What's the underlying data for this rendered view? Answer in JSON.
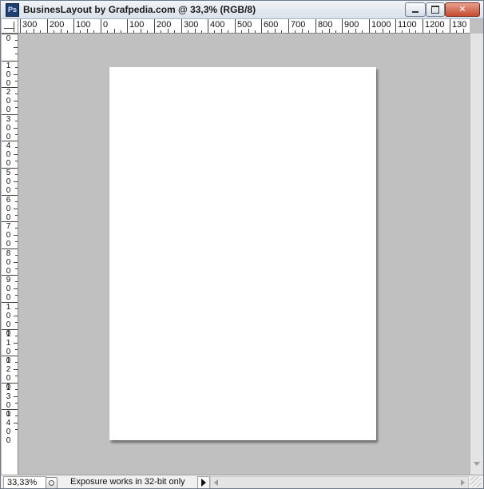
{
  "window": {
    "title": "BusinesLayout by Grafpedia.com @ 33,3% (RGB/8)",
    "app_icon": "Ps",
    "controls": [
      "minimize-icon",
      "maximize-icon",
      "close-icon"
    ]
  },
  "rulers": {
    "horizontal_labels": [
      "300",
      "200",
      "100",
      "0",
      "100",
      "200",
      "300",
      "400",
      "500",
      "600",
      "700",
      "800",
      "900",
      "1000",
      "1100",
      "1200",
      "130"
    ],
    "vertical_labels": [
      "0",
      "100",
      "200",
      "300",
      "400",
      "500",
      "600",
      "700",
      "800",
      "900",
      "1000",
      "1100",
      "1200",
      "1300",
      "1400"
    ],
    "unit": "px"
  },
  "document": {
    "background_color": "#ffffff",
    "canvas_color": "#c0c0c0"
  },
  "statusbar": {
    "zoom": "33,33%",
    "info": "Exposure works in 32-bit only"
  }
}
